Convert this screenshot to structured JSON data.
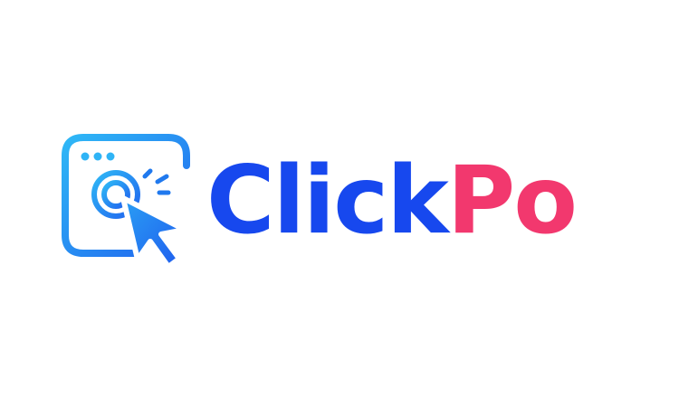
{
  "brand": {
    "name_part_1": "Click",
    "name_part_2": "Po"
  },
  "colors": {
    "primary_blue": "#1748ee",
    "accent_pink": "#f2386e",
    "icon_gradient_start": "#2fb8f6",
    "icon_gradient_end": "#2063ee"
  },
  "icons": {
    "logo_mark": "browser-window-cursor-click-icon"
  }
}
